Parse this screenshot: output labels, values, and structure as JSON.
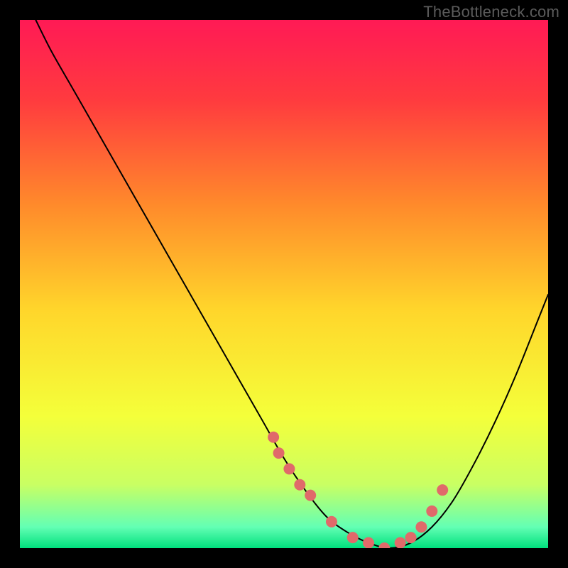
{
  "watermark": "TheBottleneck.com",
  "chart_data": {
    "type": "line",
    "title": "",
    "xlabel": "",
    "ylabel": "",
    "xlim": [
      0,
      100
    ],
    "ylim": [
      0,
      100
    ],
    "background_gradient": {
      "stops": [
        {
          "offset": 0.0,
          "color": "#ff1a55"
        },
        {
          "offset": 0.15,
          "color": "#ff3a3f"
        },
        {
          "offset": 0.35,
          "color": "#ff8a2b"
        },
        {
          "offset": 0.55,
          "color": "#ffd62b"
        },
        {
          "offset": 0.75,
          "color": "#f4ff3a"
        },
        {
          "offset": 0.88,
          "color": "#c9ff63"
        },
        {
          "offset": 0.96,
          "color": "#63ffb4"
        },
        {
          "offset": 1.0,
          "color": "#00e07d"
        }
      ]
    },
    "series": [
      {
        "name": "bottleneck-curve",
        "color": "#000000",
        "stroke_width": 2,
        "x": [
          3,
          6,
          10,
          14,
          18,
          22,
          26,
          30,
          34,
          38,
          42,
          46,
          50,
          54,
          58,
          62,
          66,
          70,
          74,
          78,
          82,
          86,
          90,
          94,
          98,
          100
        ],
        "values": [
          100,
          94,
          87,
          80,
          73,
          66,
          59,
          52,
          45,
          38,
          31,
          24,
          17,
          11,
          6,
          3,
          1,
          0,
          1,
          4,
          9,
          16,
          24,
          33,
          43,
          48
        ]
      }
    ],
    "markers": {
      "name": "data-points",
      "color": "#e06a6a",
      "radius": 8,
      "x": [
        48,
        49,
        51,
        53,
        55,
        59,
        63,
        66,
        69,
        72,
        74,
        76,
        78,
        80
      ],
      "values": [
        21,
        18,
        15,
        12,
        10,
        5,
        2,
        1,
        0,
        1,
        2,
        4,
        7,
        11
      ]
    }
  }
}
